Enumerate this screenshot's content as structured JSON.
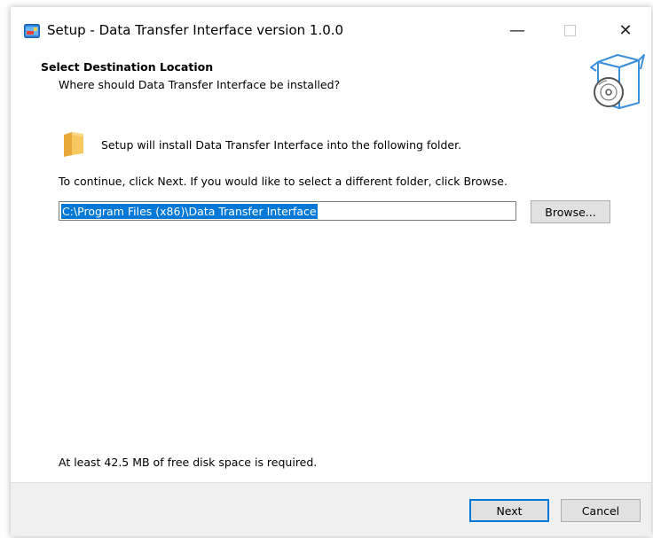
{
  "window": {
    "title": "Setup - Data Transfer Interface version 1.0.0",
    "controls": {
      "minimize": "—",
      "close": "✕"
    }
  },
  "header": {
    "title": "Select Destination Location",
    "subtitle": "Where should Data Transfer Interface be installed?"
  },
  "content": {
    "info": "Setup will install Data Transfer Interface into the following folder.",
    "instruction": "To continue, click Next. If you would like to select a different folder, click Browse.",
    "path_value": "C:\\Program Files (x86)\\Data Transfer Interface",
    "browse_label": "Browse...",
    "disk_space": "At least 42.5 MB of free disk space is required."
  },
  "footer": {
    "next_label": "Next",
    "cancel_label": "Cancel"
  },
  "colors": {
    "accent": "#0078d7",
    "footer_bg": "#f0f0f0",
    "button_bg": "#e1e1e1",
    "folder": "#f4c25b"
  }
}
